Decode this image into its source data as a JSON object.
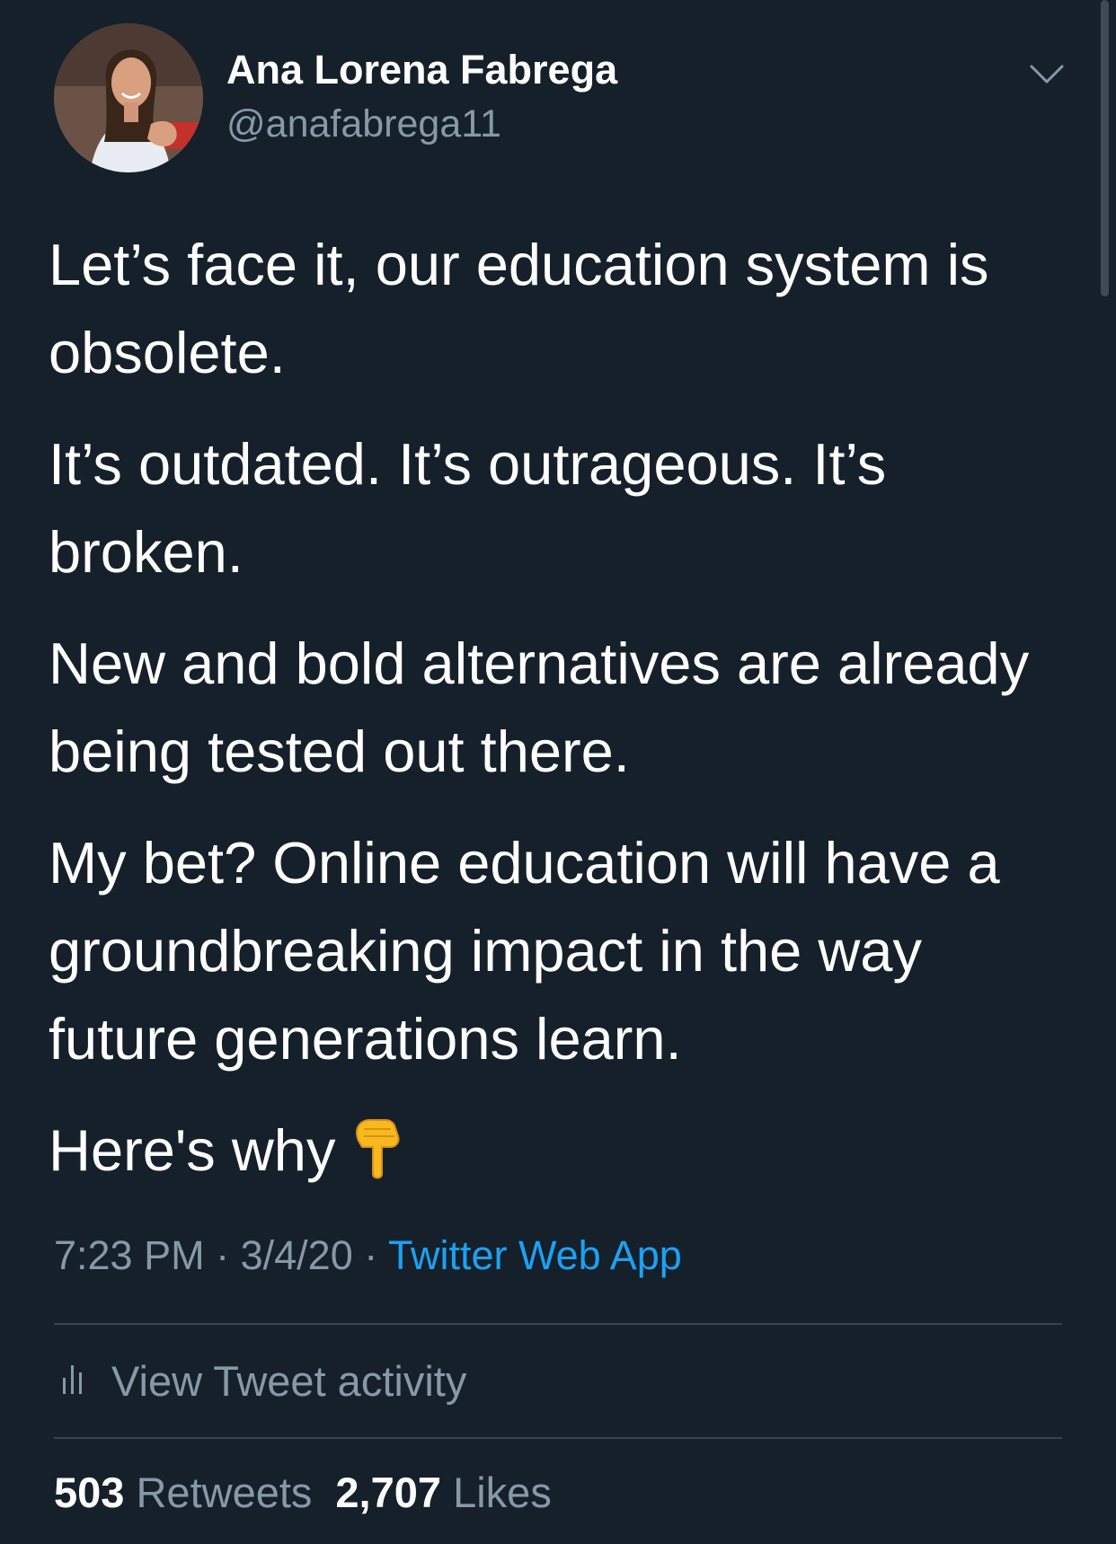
{
  "author": {
    "name": "Ana Lorena Fabrega",
    "handle": "@anafabrega11"
  },
  "tweet": {
    "paragraphs": [
      "Let’s face it, our education system is obsolete.",
      "It’s outdated. It’s outrageous. It’s broken.",
      "New and bold alternatives are already being tested out there.",
      "My bet? Online education will have a groundbreaking impact in the way future generations learn."
    ],
    "closing": "Here's why",
    "emoji_icon": "backhand-index-pointing-down-icon"
  },
  "meta": {
    "time": "7:23 PM",
    "separator": "·",
    "date": "3/4/20",
    "source": "Twitter Web App"
  },
  "activity": {
    "label": "View Tweet activity"
  },
  "stats": {
    "retweets_count": "503",
    "retweets_label": "Retweets",
    "likes_count": "2,707",
    "likes_label": "Likes"
  },
  "colors": {
    "background": "#15202b",
    "text_primary": "#ffffff",
    "text_secondary": "#8899a6",
    "link": "#1da1f2",
    "divider": "#38444d"
  }
}
